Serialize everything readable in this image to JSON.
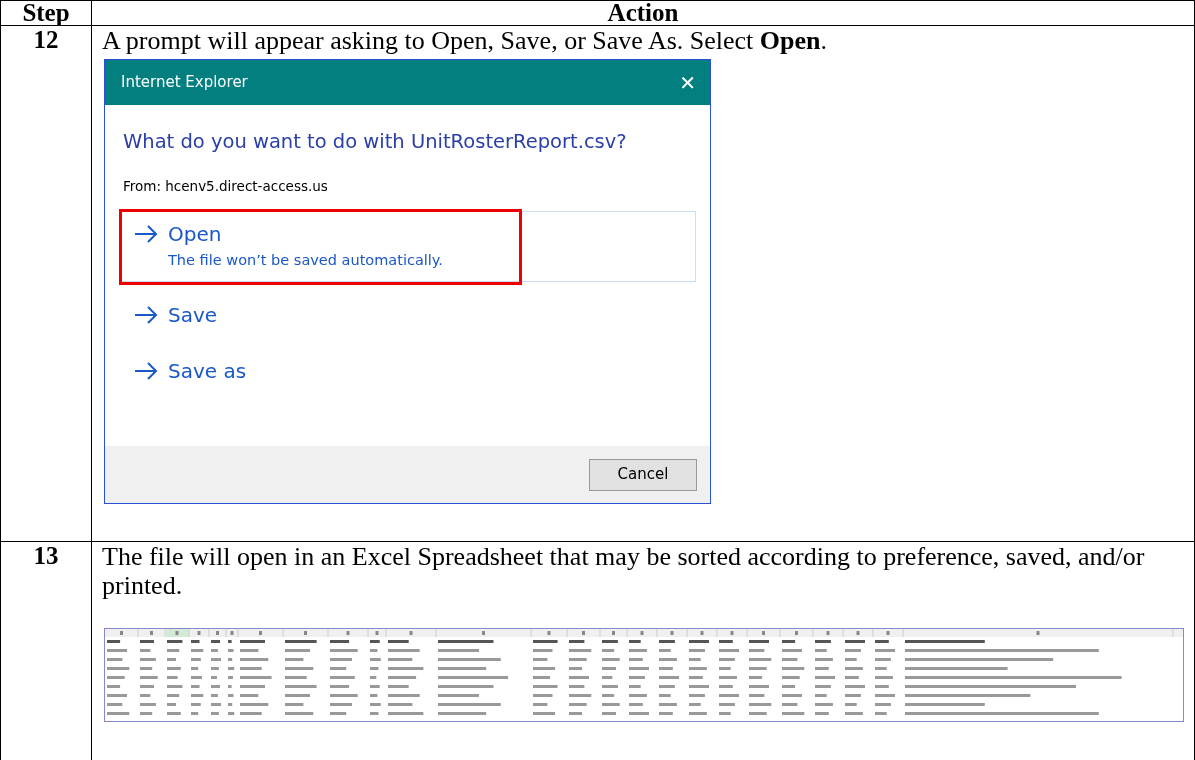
{
  "table": {
    "columns": [
      "Step",
      "Action"
    ],
    "rows": [
      {
        "step": "12",
        "kind": "dialog",
        "text": "A prompt will appear asking to Open, Save, or Save As.  Select **Open**.",
        "dialog": {
          "title": "Internet Explorer",
          "close": "✕",
          "heading": "What do you want to do with UnitRosterReport.csv?",
          "from": "From: hcenv5.direct-access.us",
          "options": [
            {
              "label": "Open",
              "note": "The file won’t be saved automatically.",
              "highlighted": true
            },
            {
              "label": "Save",
              "highlighted": false
            },
            {
              "label": "Save as",
              "highlighted": false
            }
          ],
          "cancel": "Cancel"
        }
      },
      {
        "step": "13",
        "kind": "spreadsheet",
        "text": "The file will open in an Excel Spreadsheet that may be sorted according to preference, saved, and/or printed."
      }
    ]
  }
}
